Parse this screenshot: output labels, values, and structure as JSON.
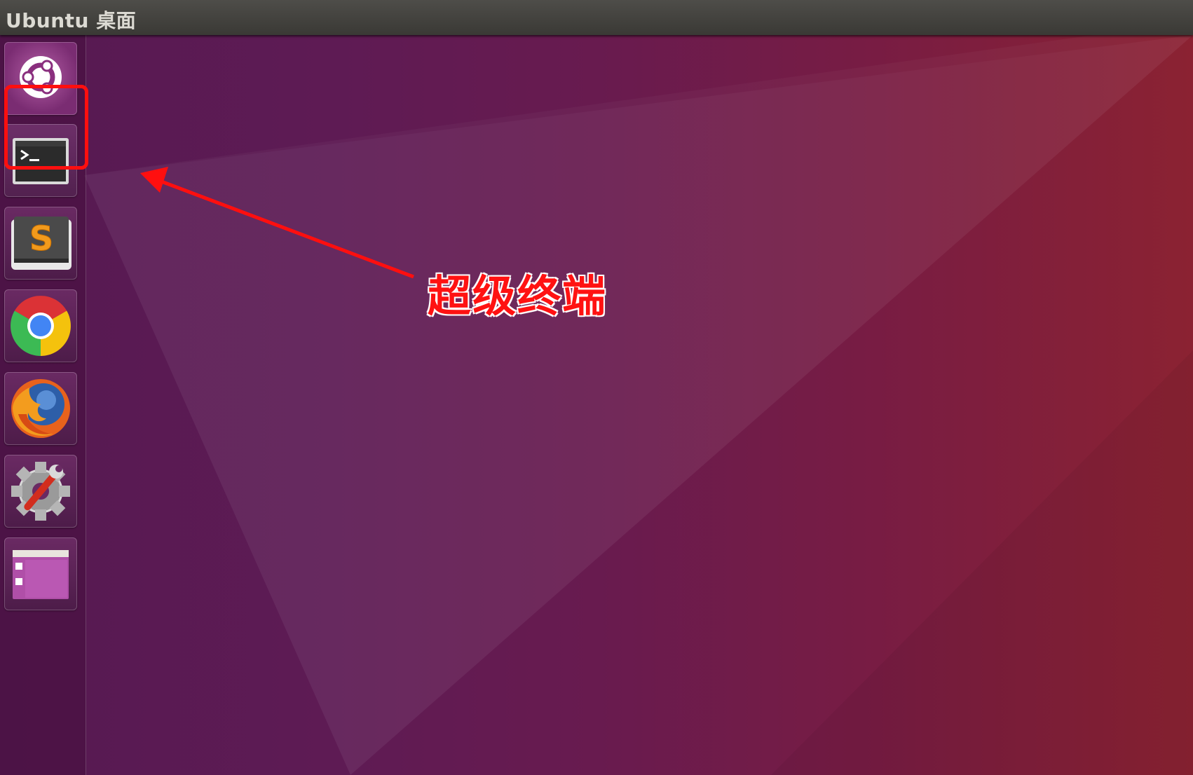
{
  "top_panel": {
    "title": "Ubuntu 桌面"
  },
  "launcher": {
    "items": [
      {
        "name": "dash-home",
        "icon": "ubuntu-logo-icon"
      },
      {
        "name": "terminal",
        "icon": "terminal-icon",
        "highlighted": true
      },
      {
        "name": "sublime-text",
        "icon": "sublime-text-icon"
      },
      {
        "name": "chrome",
        "icon": "chrome-icon"
      },
      {
        "name": "firefox",
        "icon": "firefox-icon"
      },
      {
        "name": "system-settings",
        "icon": "gear-wrench-icon"
      },
      {
        "name": "workspace-switcher",
        "icon": "workspace-icon"
      }
    ]
  },
  "annotation": {
    "label": "超级终端",
    "color": "#ff0f0f"
  },
  "colors": {
    "panel": "#3c3b37",
    "wallpaper_left": "#561a52",
    "wallpaper_right": "#8b2232",
    "highlight": "#ff0f0f"
  }
}
